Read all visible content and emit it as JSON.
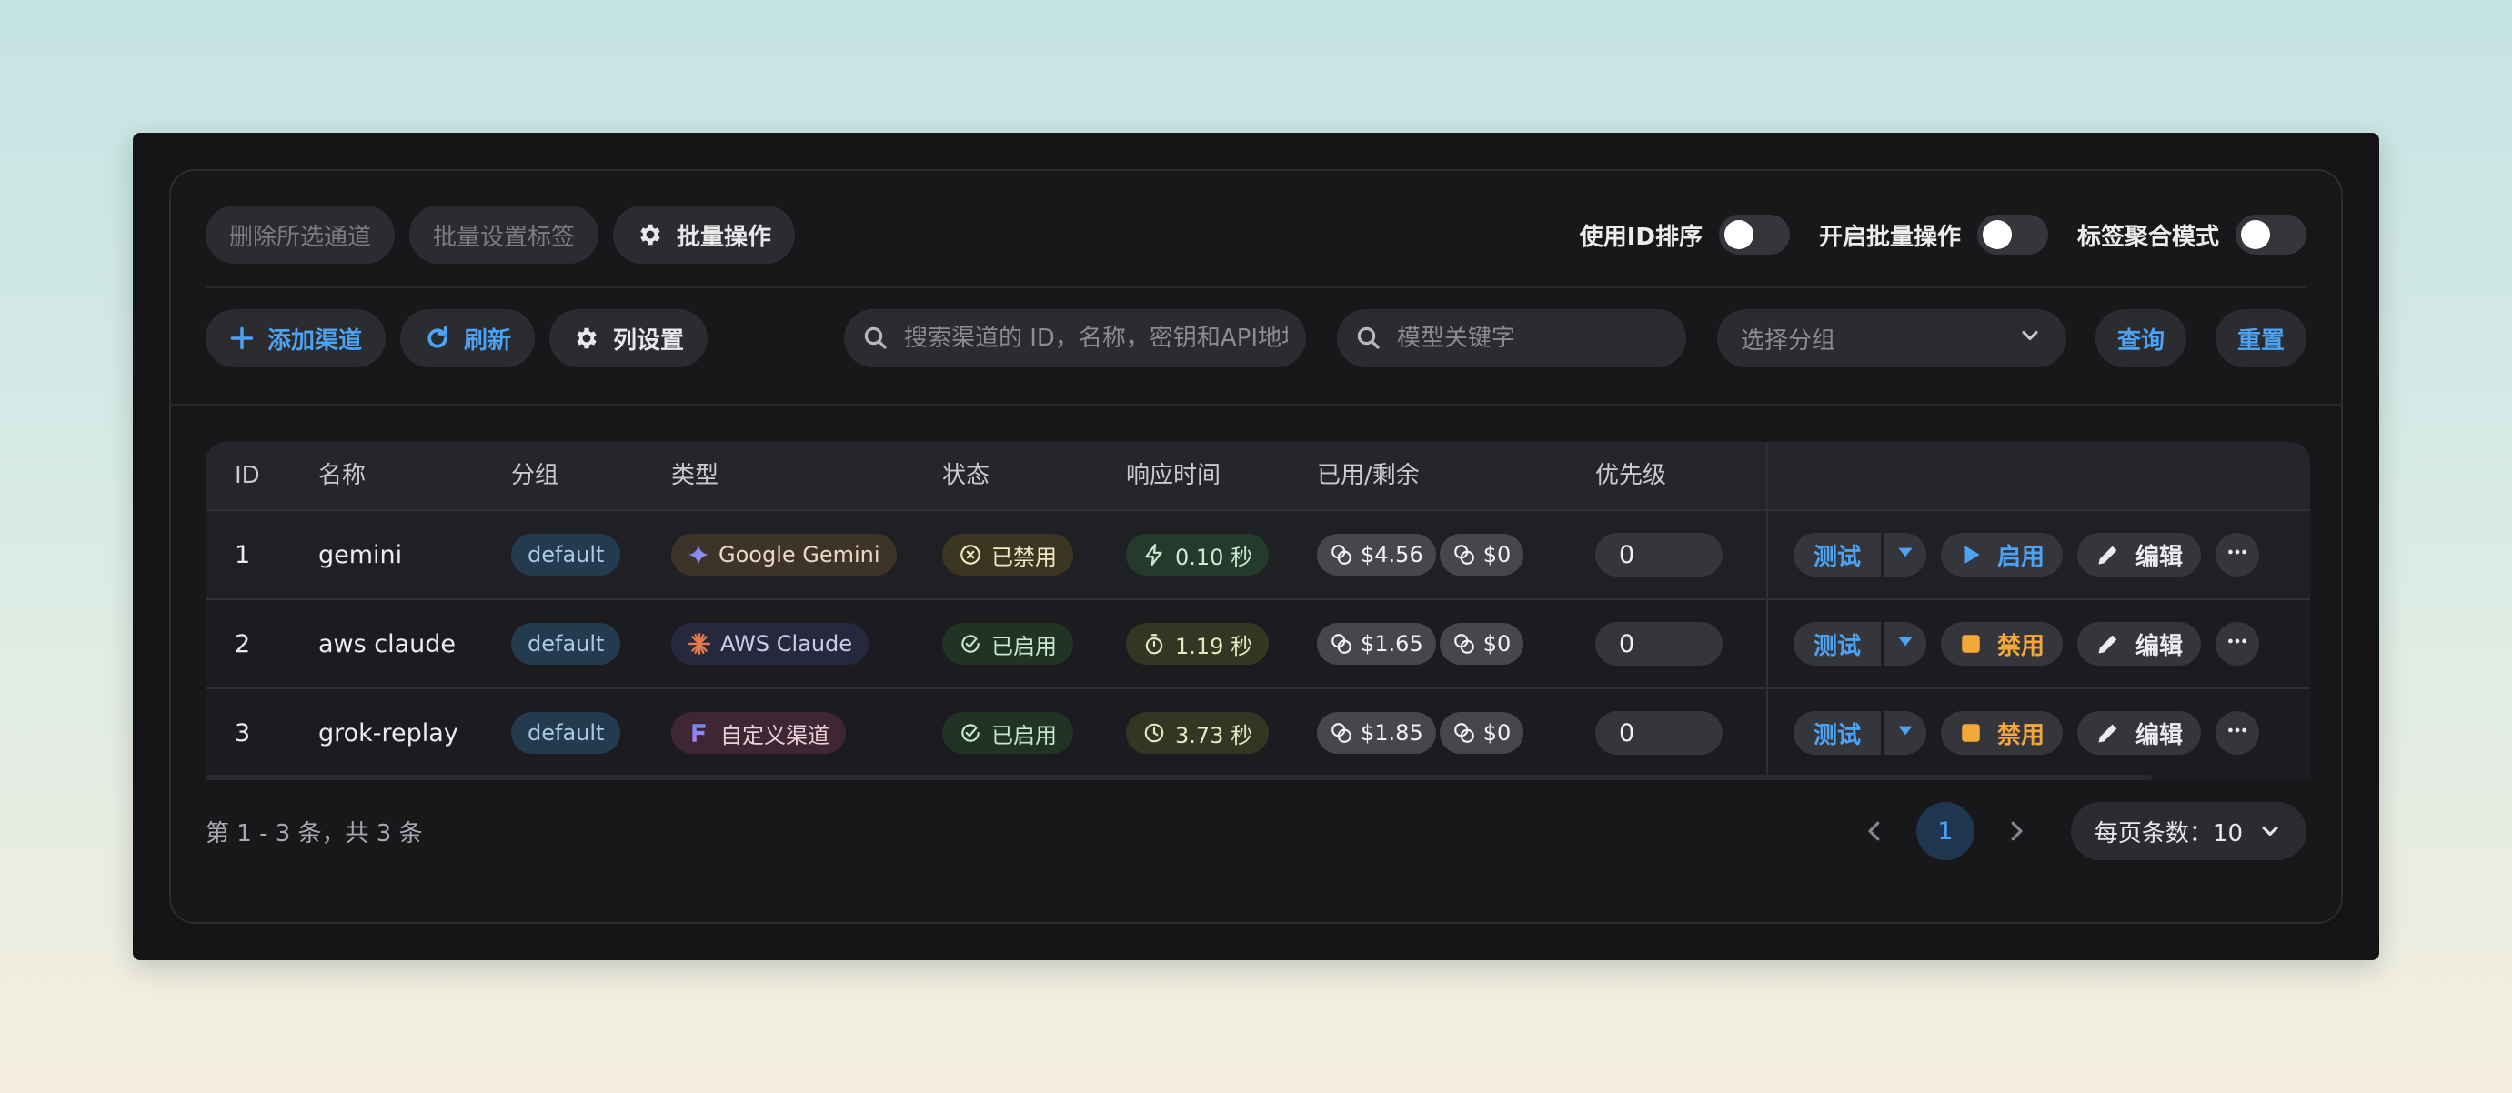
{
  "toolbar": {
    "delete_selected": "删除所选通道",
    "batch_tag": "批量设置标签",
    "batch_ops": "批量操作",
    "toggles": [
      {
        "label": "使用ID排序",
        "on": false
      },
      {
        "label": "开启批量操作",
        "on": false
      },
      {
        "label": "标签聚合模式",
        "on": false
      }
    ]
  },
  "actions": {
    "add_channel": "添加渠道",
    "refresh": "刷新",
    "column_settings": "列设置",
    "search_placeholder": "搜索渠道的 ID，名称，密钥和API地址",
    "model_placeholder": "模型关键字",
    "group_placeholder": "选择分组",
    "query": "查询",
    "reset": "重置"
  },
  "table": {
    "headers": [
      "ID",
      "名称",
      "分组",
      "类型",
      "状态",
      "响应时间",
      "已用/剩余",
      "优先级"
    ],
    "rows": [
      {
        "id": "1",
        "name": "gemini",
        "group": "default",
        "type": "Google Gemini",
        "type_icon": "gemini-star-icon",
        "status": "已禁用",
        "status_kind": "disabled",
        "response": "0.10 秒",
        "response_icon": "bolt-icon",
        "used": "$4.56",
        "remaining": "$0",
        "priority": "0",
        "test": "测试",
        "toggle_action": "启用",
        "toggle_icon": "play-icon",
        "edit": "编辑"
      },
      {
        "id": "2",
        "name": "aws claude",
        "group": "default",
        "type": "AWS Claude",
        "type_icon": "claude-burst-icon",
        "status": "已启用",
        "status_kind": "enabled",
        "response": "1.19 秒",
        "response_icon": "stopwatch-icon",
        "used": "$1.65",
        "remaining": "$0",
        "priority": "0",
        "test": "测试",
        "toggle_action": "禁用",
        "toggle_icon": "stop-icon",
        "edit": "编辑"
      },
      {
        "id": "3",
        "name": "grok-replay",
        "group": "default",
        "type": "自定义渠道",
        "type_icon": "custom-channel-icon",
        "status": "已启用",
        "status_kind": "enabled",
        "response": "3.73 秒",
        "response_icon": "clock-icon",
        "used": "$1.85",
        "remaining": "$0",
        "priority": "0",
        "test": "测试",
        "toggle_action": "禁用",
        "toggle_icon": "stop-icon",
        "edit": "编辑"
      }
    ]
  },
  "footer": {
    "summary": "第 1 - 3 条，共 3 条",
    "current_page": "1",
    "page_size": "每页条数：10"
  },
  "colors": {
    "accent": "#4ea2f2",
    "warning": "#f5a83a",
    "window": "#141417"
  }
}
